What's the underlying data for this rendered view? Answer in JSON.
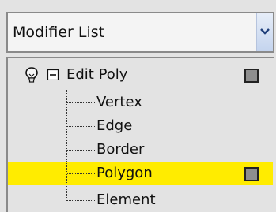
{
  "modifier_dropdown": {
    "label": "Modifier List",
    "icon": "chevron-down-icon"
  },
  "stack": {
    "root": {
      "label": "Edit Poly",
      "bulb_icon": "lightbulb-icon",
      "toggle_icon": "collapse-minus-icon"
    },
    "subobjects": [
      {
        "label": "Vertex",
        "selected": false
      },
      {
        "label": "Edge",
        "selected": false
      },
      {
        "label": "Border",
        "selected": false
      },
      {
        "label": "Polygon",
        "selected": true
      },
      {
        "label": "Element",
        "selected": false
      }
    ]
  },
  "colors": {
    "selection": "#ffec00",
    "panel": "#e3e3e3"
  }
}
